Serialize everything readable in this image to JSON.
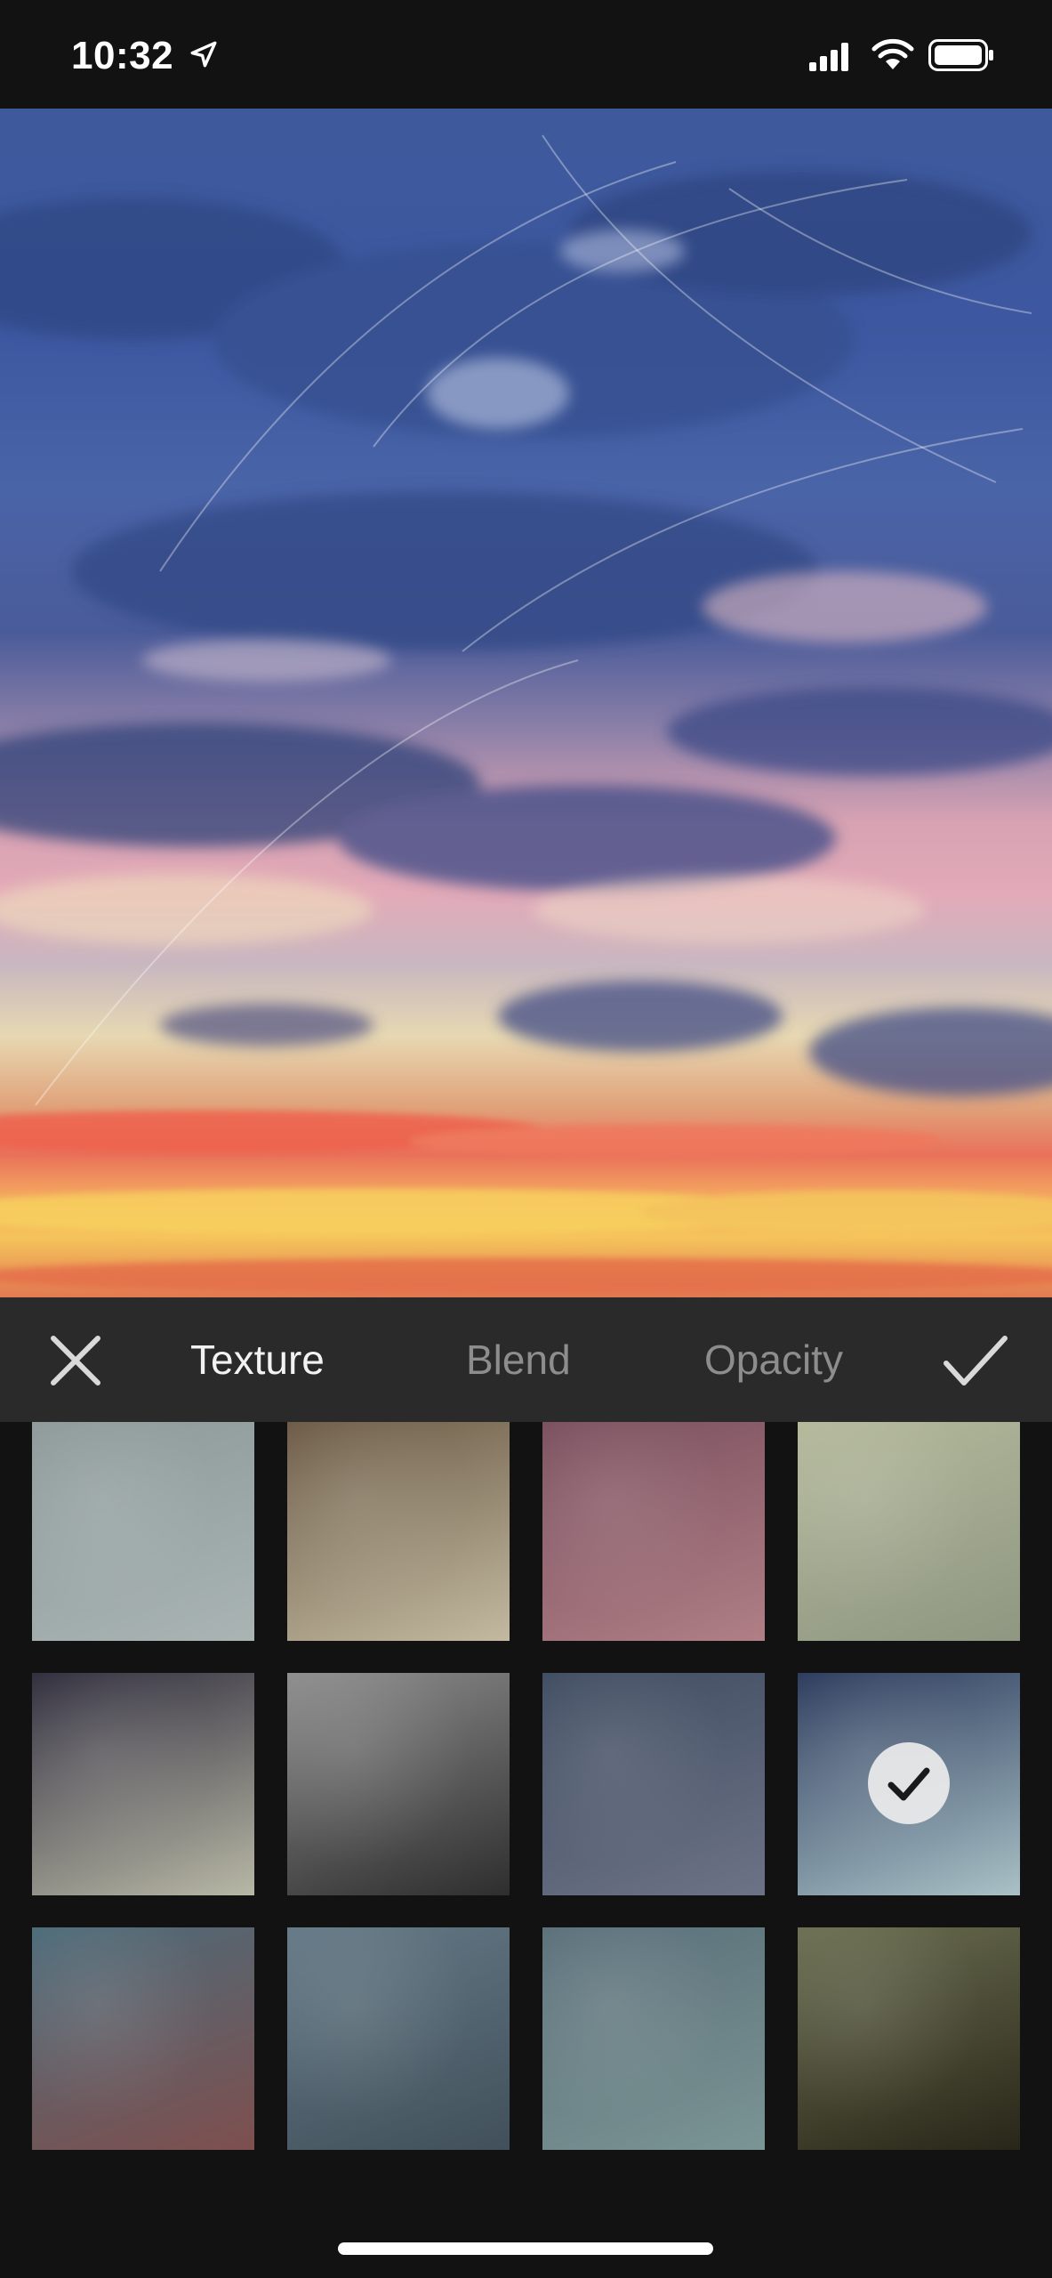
{
  "status_bar": {
    "time": "10:32"
  },
  "editor": {
    "tabs": [
      {
        "label": "Texture",
        "selected": true
      },
      {
        "label": "Blend",
        "selected": false
      },
      {
        "label": "Opacity",
        "selected": false
      }
    ],
    "cancel_icon": "close-icon",
    "confirm_icon": "checkmark-icon"
  },
  "textures": {
    "selected_index": 7,
    "tiles": [
      {
        "colors": [
          "#8d999a",
          "#a9b4b3"
        ]
      },
      {
        "colors": [
          "#6b5a45",
          "#c2b9a0"
        ]
      },
      {
        "colors": [
          "#7a4f5e",
          "#b07f86"
        ]
      },
      {
        "colors": [
          "#b4b99b",
          "#8f9782"
        ]
      },
      {
        "colors": [
          "#2f2c3c",
          "#b8b8a6"
        ]
      },
      {
        "colors": [
          "#8e8e8e",
          "#2e2e2e"
        ]
      },
      {
        "colors": [
          "#3f4c61",
          "#6d7386"
        ]
      },
      {
        "colors": [
          "#2b3a5c",
          "#a9c1c6"
        ]
      },
      {
        "colors": [
          "#4c6b79",
          "#7e4f4e"
        ]
      },
      {
        "colors": [
          "#647986",
          "#41505b"
        ]
      },
      {
        "colors": [
          "#5a6f79",
          "#7b9494"
        ]
      },
      {
        "colors": [
          "#6c6f52",
          "#282618"
        ]
      }
    ]
  }
}
